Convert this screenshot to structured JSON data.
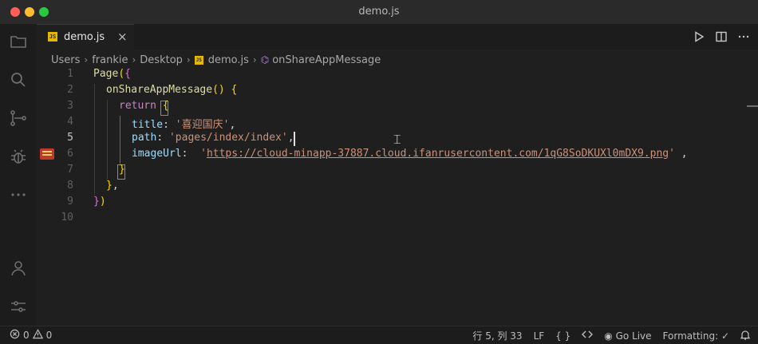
{
  "window": {
    "title": "demo.js"
  },
  "tab": {
    "badge": "JS",
    "label": "demo.js",
    "close": "×"
  },
  "breadcrumb": {
    "items": [
      "Users",
      "frankie",
      "Desktop"
    ],
    "file": "demo.js",
    "symbol": "onShareAppMessage",
    "separator": "›"
  },
  "editor": {
    "lines": [
      {
        "n": "1",
        "text": "Page({"
      },
      {
        "n": "2",
        "text": "onShareAppMessage() {"
      },
      {
        "n": "3",
        "text": "return {"
      },
      {
        "n": "4",
        "text": "title: '喜迎国庆',"
      },
      {
        "n": "5",
        "text": "path: 'pages/index/index',"
      },
      {
        "n": "6",
        "text": "imageUrl: 'https://cloud-minapp-37887.cloud.ifanrusercontent.com/1qG8SoDKUXl0mDX9.png',"
      },
      {
        "n": "7",
        "text": "}"
      },
      {
        "n": "8",
        "text": "},"
      },
      {
        "n": "9",
        "text": "})"
      },
      {
        "n": "10",
        "text": ""
      }
    ],
    "tokens": {
      "page_fn": "Page",
      "page_paren": "(",
      "page_brace": "{",
      "method": "onShareAppMessage",
      "method_parens": "()",
      "method_brace": "{",
      "return_kw": "return",
      "return_brace": "{",
      "title_key": "title",
      "title_val": "'喜迎国庆'",
      "path_key": "path",
      "path_val": "'pages/index/index'",
      "image_key": "imageUrl",
      "image_quote": "'",
      "image_url": "https://cloud-minapp-37887.cloud.ifanrusercontent.com/1qG8SoDKUXl0mDX9.png",
      "colon": ":",
      "comma": ",",
      "close_inner": "}",
      "close_method": "}",
      "close_page_brace": "}",
      "close_page_paren": ")"
    },
    "active_line": "5"
  },
  "status": {
    "errors": "0",
    "warnings": "0",
    "position": "行 5, 列 33",
    "eol": "LF",
    "braces": "{ }",
    "golive": "Go Live",
    "formatting": "Formatting: ✓"
  },
  "colors": {
    "accent_red": "#ff5f57",
    "accent_yellow": "#febc2e",
    "accent_green": "#28c840",
    "js_badge": "#e5b800",
    "string": "#ce9178",
    "property": "#9cdcfe"
  }
}
